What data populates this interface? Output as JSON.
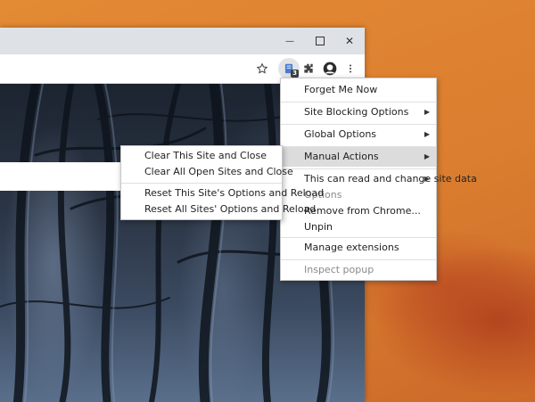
{
  "window_controls": {
    "minimize": "—",
    "maximize": "☐",
    "close": "✕"
  },
  "toolbar_icons": [
    "star-icon",
    "extension-icon",
    "puzzle-icon",
    "avatar",
    "more-icon"
  ],
  "extension_badge": "3",
  "context_menu": {
    "items": [
      {
        "label": "Forget Me Now",
        "submenu": false,
        "disabled": false
      },
      {
        "label": "Site Blocking Options",
        "submenu": true,
        "disabled": false
      },
      {
        "label": "Global Options",
        "submenu": true,
        "disabled": false
      },
      {
        "label": "Manual Actions",
        "submenu": true,
        "disabled": false,
        "highlighted": true
      },
      {
        "label": "This can read and change site data",
        "submenu": true,
        "disabled": false
      },
      {
        "label": "Options",
        "submenu": false,
        "disabled": true
      },
      {
        "label": "Remove from Chrome...",
        "submenu": false,
        "disabled": false
      },
      {
        "label": "Unpin",
        "submenu": false,
        "disabled": false
      },
      {
        "label": "Manage extensions",
        "submenu": false,
        "disabled": false
      },
      {
        "label": "Inspect popup",
        "submenu": false,
        "disabled": true
      }
    ]
  },
  "submenu": {
    "items": [
      {
        "label": "Clear This Site and Close"
      },
      {
        "label": "Clear All Open Sites and Close"
      },
      {
        "label": "Reset This Site's Options and Reload"
      },
      {
        "label": "Reset All Sites' Options and Reload"
      }
    ]
  }
}
